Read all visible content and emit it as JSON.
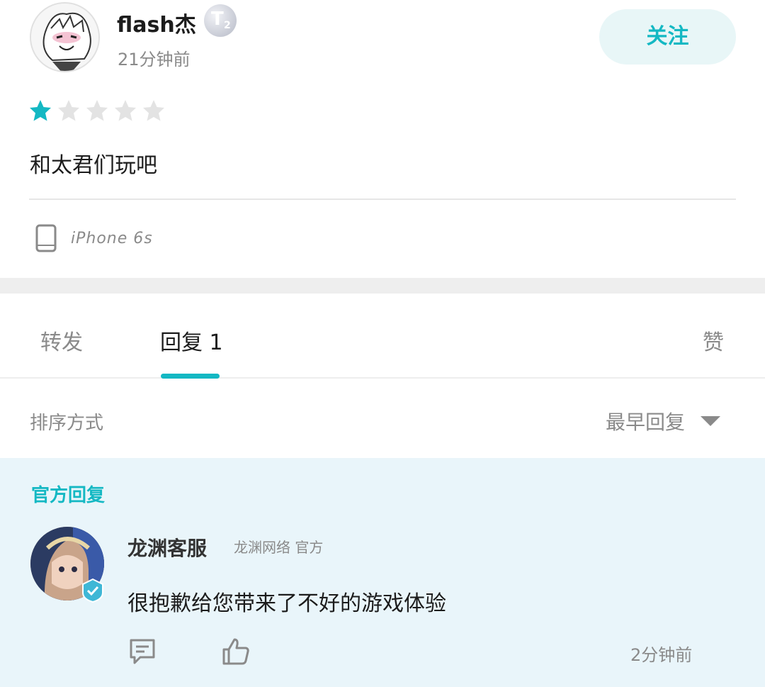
{
  "review": {
    "author_name": "flash杰",
    "level_badge_letter": "T",
    "level_badge_number": "2",
    "time": "21分钟前",
    "follow_label": "关注",
    "rating": 1,
    "rating_max": 5,
    "text": "和太君们玩吧",
    "device": "iPhone 6s"
  },
  "tabs": {
    "repost_label": "转发",
    "reply_label": "回复 1",
    "like_label": "赞"
  },
  "sort": {
    "label": "排序方式",
    "selected": "最早回复"
  },
  "official_reply": {
    "section_title": "官方回复",
    "name": "龙渊客服",
    "org": "龙渊网络 官方",
    "text": "很抱歉给您带来了不好的游戏体验",
    "time": "2分钟前"
  },
  "colors": {
    "accent": "#14b8c3",
    "official_bg": "#e9f5fa",
    "follow_bg": "#e8f6f7",
    "star_empty": "#e3e3e3"
  },
  "icons": {
    "device": "phone-icon",
    "comment": "comment-icon",
    "like": "thumbs-up-icon",
    "verified": "verified-icon",
    "dropdown": "chevron-down-icon"
  }
}
